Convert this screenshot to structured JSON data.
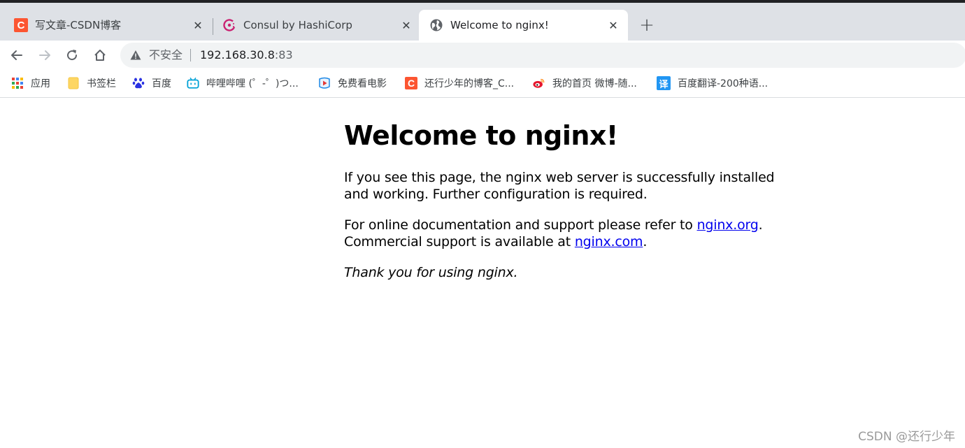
{
  "tabs": [
    {
      "title": "写文章-CSDN博客",
      "icon": "csdn-icon",
      "active": false
    },
    {
      "title": "Consul by HashiCorp",
      "icon": "consul-icon",
      "active": false
    },
    {
      "title": "Welcome to nginx!",
      "icon": "globe-icon",
      "active": true
    }
  ],
  "newtab_label": "+",
  "close_glyph": "✕",
  "address": {
    "security_label": "不安全",
    "host": "192.168.30.8",
    "port": ":83"
  },
  "bookmarks": [
    {
      "label": "应用",
      "icon": "apps-grid-icon"
    },
    {
      "label": "书签栏",
      "icon": "folder-icon"
    },
    {
      "label": "百度",
      "icon": "baidu-paw-icon"
    },
    {
      "label": "哔哩哔哩 (゜-゜)つ...",
      "icon": "bilibili-icon"
    },
    {
      "label": "免费看电影",
      "icon": "video-play-icon"
    },
    {
      "label": "还行少年的博客_C...",
      "icon": "csdn-icon"
    },
    {
      "label": "我的首页 微博-随...",
      "icon": "weibo-icon"
    },
    {
      "label": "百度翻译-200种语...",
      "icon": "translate-icon",
      "glyph": "译"
    }
  ],
  "page": {
    "heading": "Welcome to nginx!",
    "para1": "If you see this page, the nginx web server is successfully installed and working. Further configuration is required.",
    "para2_prefix": "For online documentation and support please refer to ",
    "link1": "nginx.org",
    "para2_mid": ".",
    "para2_line2_prefix": "Commercial support is available at ",
    "link2": "nginx.com",
    "para2_suffix": ".",
    "thanks": "Thank you for using nginx."
  },
  "watermark": "CSDN @还行少年",
  "colors": {
    "csdn": "#fc5531",
    "consul": "#ca2171",
    "link": "#0000ee",
    "tabstrip": "#dee1e6",
    "omnibox": "#f1f3f4"
  }
}
